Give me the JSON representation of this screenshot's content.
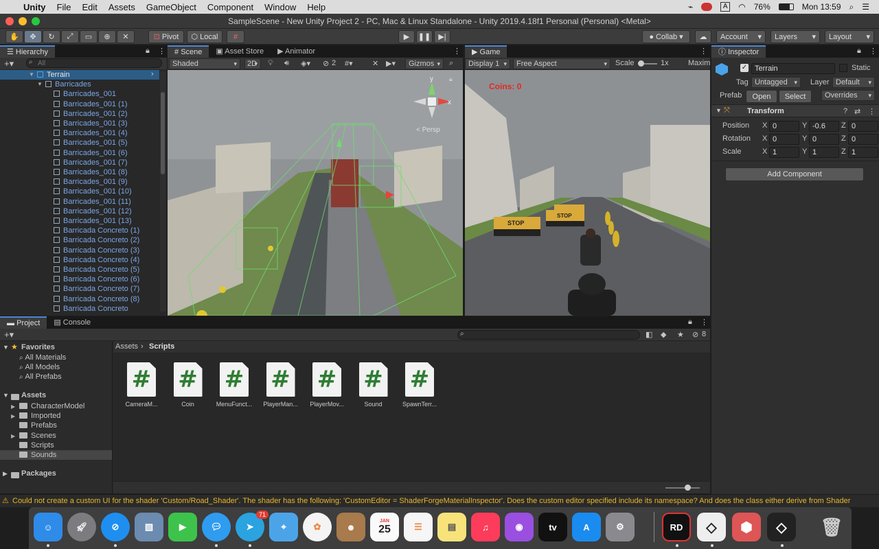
{
  "menubar": {
    "app_name": "Unity",
    "items": [
      "File",
      "Edit",
      "Assets",
      "GameObject",
      "Component",
      "Window",
      "Help"
    ],
    "battery": "76%",
    "clock": "Mon 13:59"
  },
  "window": {
    "title": "SampleScene - New Unity Project 2 - PC, Mac & Linux Standalone - Unity 2019.4.18f1 Personal (Personal) <Metal>"
  },
  "toolbar": {
    "pivot": "Pivot",
    "local": "Local",
    "collab": "Collab",
    "account": "Account",
    "layers": "Layers",
    "layout": "Layout"
  },
  "hierarchy": {
    "tab": "Hierarchy",
    "search_placeholder": "All",
    "items": [
      "Terrain",
      "Barricades",
      "Barricades_001",
      "Barricades_001 (1)",
      "Barricades_001 (2)",
      "Barricades_001 (3)",
      "Barricades_001 (4)",
      "Barricades_001 (5)",
      "Barricades_001 (6)",
      "Barricades_001 (7)",
      "Barricades_001 (8)",
      "Barricades_001 (9)",
      "Barricades_001 (10)",
      "Barricades_001 (11)",
      "Barricades_001 (12)",
      "Barricades_001 (13)",
      "Barricada Concreto (1)",
      "Barricada Concreto (2)",
      "Barricada Concreto (3)",
      "Barricada Concreto (4)",
      "Barricada Concreto (5)",
      "Barricada Concreto (6)",
      "Barricada Concreto (7)",
      "Barricada Concreto (8)",
      "Barricada Concreto"
    ]
  },
  "scene": {
    "tabs": [
      "Scene",
      "Asset Store",
      "Animator"
    ],
    "shading": "Shaded",
    "mode2d": "2D",
    "hidden_count": "2",
    "gizmos": "Gizmos",
    "persp": "< Persp",
    "gizmo_y": "y",
    "gizmo_x": "x"
  },
  "game": {
    "tab": "Game",
    "display": "Display 1",
    "aspect": "Free Aspect",
    "scale_label": "Scale",
    "scale_value": "1x",
    "maximize": "Maxim",
    "coins_text": "Coins: 0",
    "stop_sign": "STOP"
  },
  "inspector": {
    "tab": "Inspector",
    "object_name": "Terrain",
    "static": "Static",
    "tag_label": "Tag",
    "tag": "Untagged",
    "layer_label": "Layer",
    "layer": "Default",
    "prefab_label": "Prefab",
    "open": "Open",
    "select": "Select",
    "overrides": "Overrides",
    "component": "Transform",
    "rows": [
      {
        "label": "Position",
        "x": "0",
        "y": "-0.6",
        "z": "0"
      },
      {
        "label": "Rotation",
        "x": "0",
        "y": "0",
        "z": "0"
      },
      {
        "label": "Scale",
        "x": "1",
        "y": "1",
        "z": "1"
      }
    ],
    "axis_x": "X",
    "axis_y": "Y",
    "axis_z": "Z",
    "add_component": "Add Component"
  },
  "project": {
    "tabs": [
      "Project",
      "Console"
    ],
    "hidden_count": "8",
    "breadcrumb_root": "Assets",
    "breadcrumb_current": "Scripts",
    "favorites_label": "Favorites",
    "favorites": [
      "All Materials",
      "All Models",
      "All Prefabs"
    ],
    "assets_label": "Assets",
    "asset_folders": [
      "CharacterModel",
      "Imported",
      "Prefabs",
      "Scenes",
      "Scripts",
      "Sounds"
    ],
    "packages_label": "Packages",
    "scripts": [
      "CameraM...",
      "Coin",
      "MenuFunct...",
      "PlayerMan...",
      "PlayerMov...",
      "Sound",
      "SpawnTerr..."
    ],
    "script_glyph": "#"
  },
  "status": {
    "message": "Could not create a custom UI for the shader 'Custom/Road_Shader'. The shader has the following: 'CustomEditor = ShaderForgeMaterialInspector'. Does the custom editor specified include its namespace? And does the class either derive from Shader"
  },
  "dock": {
    "telegram_badge": "71",
    "calendar_month": "JAN",
    "calendar_day": "25",
    "appletv": "tv",
    "rider": "RD"
  }
}
